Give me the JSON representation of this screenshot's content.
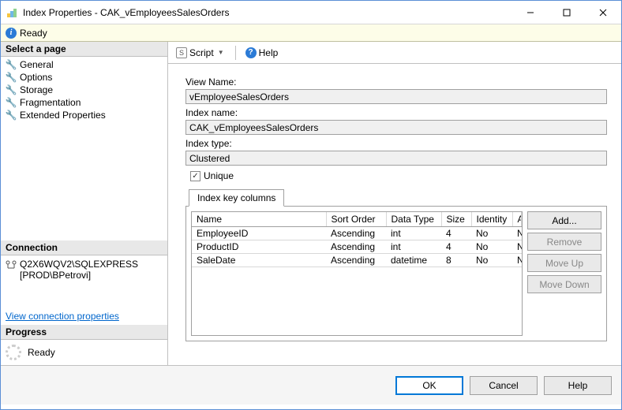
{
  "window": {
    "title": "Index Properties - CAK_vEmployeesSalesOrders"
  },
  "status": {
    "text": "Ready"
  },
  "sidebar": {
    "select_page": "Select a page",
    "items": [
      {
        "label": "General"
      },
      {
        "label": "Options"
      },
      {
        "label": "Storage"
      },
      {
        "label": "Fragmentation"
      },
      {
        "label": "Extended Properties"
      }
    ],
    "connection_header": "Connection",
    "connection_server": "Q2X6WQV2\\SQLEXPRESS",
    "connection_user": "[PROD\\BPetrovi]",
    "view_conn_link": "View connection properties",
    "progress_header": "Progress",
    "progress_text": "Ready"
  },
  "toolbar": {
    "script": "Script",
    "help": "Help"
  },
  "form": {
    "view_name_label": "View Name:",
    "view_name": "vEmployeeSalesOrders",
    "index_name_label": "Index name:",
    "index_name": "CAK_vEmployeesSalesOrders",
    "index_type_label": "Index type:",
    "index_type": "Clustered",
    "unique_label": "Unique",
    "unique_checked": true
  },
  "tab": {
    "label": "Index key columns",
    "headers": [
      "Name",
      "Sort Order",
      "Data Type",
      "Size",
      "Identity",
      "Allow NULLs"
    ],
    "rows": [
      {
        "name": "EmployeeID",
        "sort": "Ascending",
        "type": "int",
        "size": "4",
        "identity": "No",
        "nulls": "No"
      },
      {
        "name": "ProductID",
        "sort": "Ascending",
        "type": "int",
        "size": "4",
        "identity": "No",
        "nulls": "No"
      },
      {
        "name": "SaleDate",
        "sort": "Ascending",
        "type": "datetime",
        "size": "8",
        "identity": "No",
        "nulls": "No"
      }
    ],
    "buttons": {
      "add": "Add...",
      "remove": "Remove",
      "moveup": "Move Up",
      "movedown": "Move Down"
    }
  },
  "dialog": {
    "ok": "OK",
    "cancel": "Cancel",
    "help": "Help"
  }
}
